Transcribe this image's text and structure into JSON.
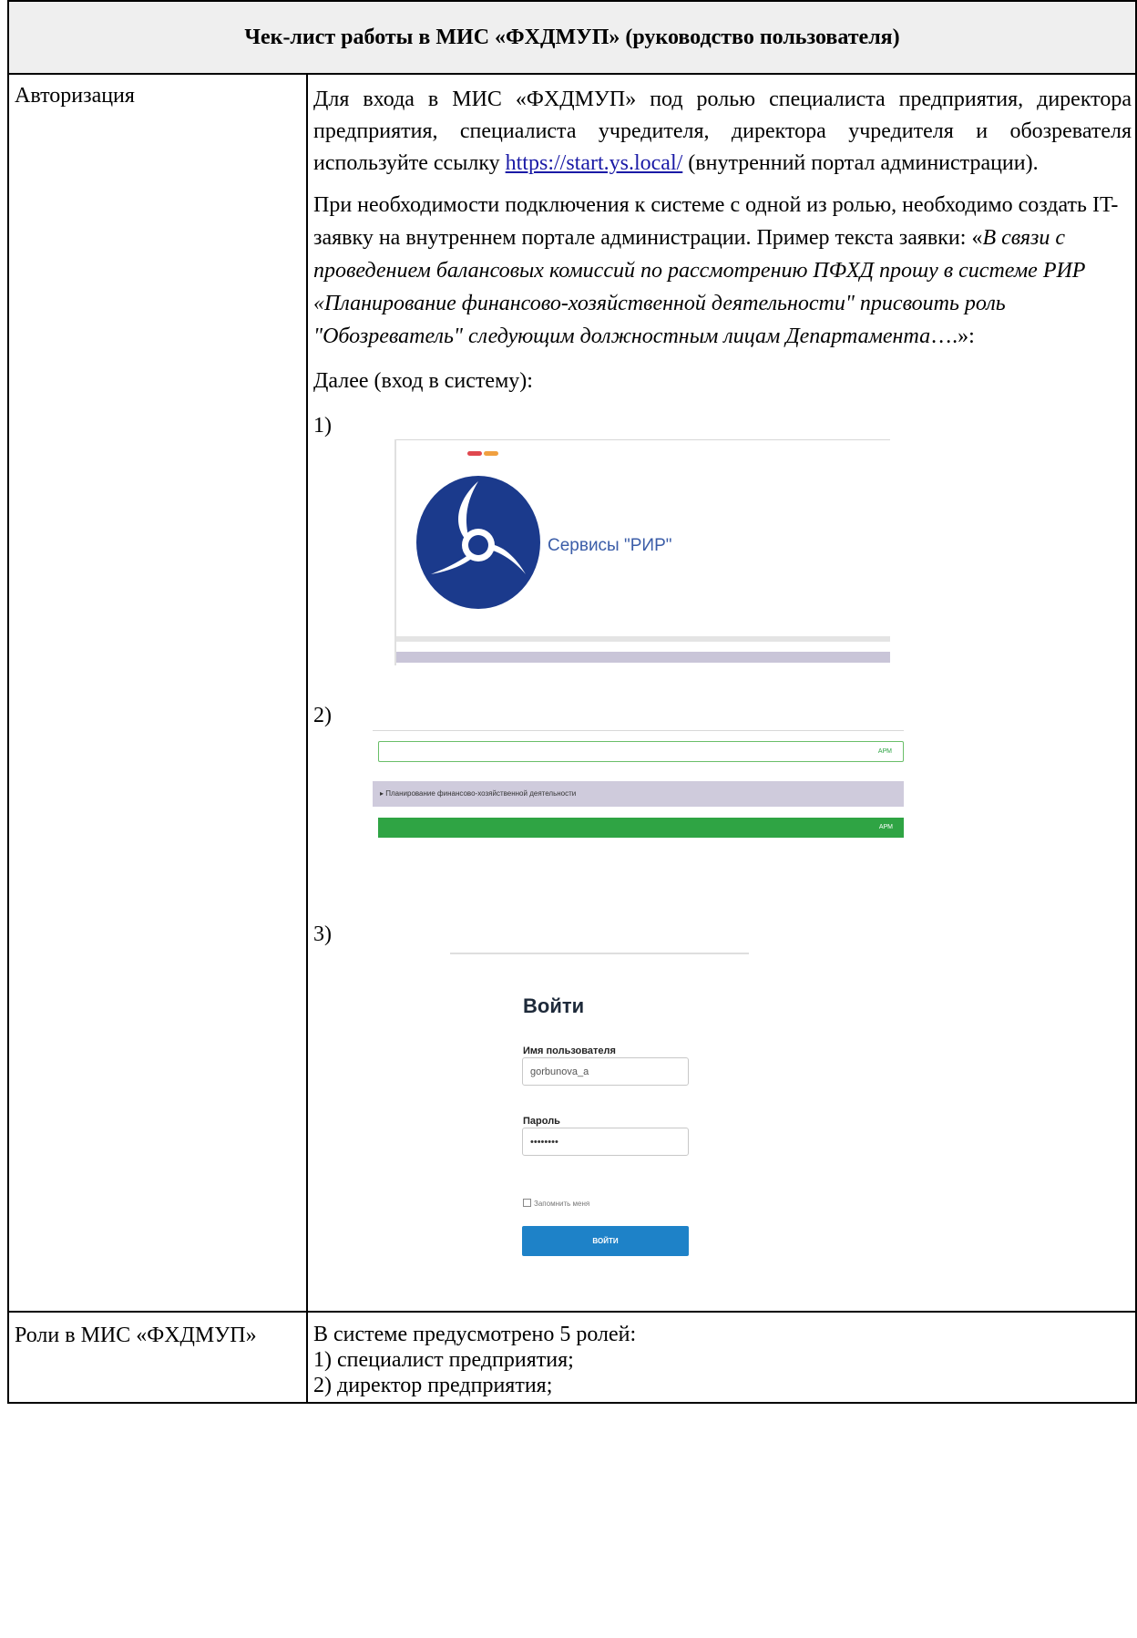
{
  "header": {
    "title": "Чек-лист работы в  МИС «ФХДМУП» (руководство пользователя)"
  },
  "rows": {
    "auth": {
      "label": "Авторизация",
      "para1_before": "Для входа в МИС «ФХДМУП» под ролью специалиста предприятия, директора предприятия, специалиста учредителя, директора учредителя и обозревателя используйте ссылку ",
      "para1_link": "https://start.ys.local/",
      "para1_after": " (внутренний портал администрации).",
      "para2_before": "При необходимости подключения к системе с одной из ролью, необходимо создать IT-заявку на внутреннем портале администрации. Пример текста заявки: «",
      "para2_italic": "В связи с проведением балансовых комиссий по рассмотрению ПФХД прошу в системе РИР «Планирование финансово-хозяйственной деятельности\" присвоить роль \"Обозреватель\" следующим должностным лицам Департамента",
      "para2_after": "….»:",
      "para3": "Далее (вход в систему):",
      "steps": [
        {
          "num": "1)",
          "service_text": "Сервисы \"РИР\""
        },
        {
          "num": "2)",
          "row_text": "▸ Планирование финансово-хозяйственной деятельности",
          "tag": "АРМ"
        },
        {
          "num": "3)",
          "login_title": "Войти",
          "username_label": "Имя пользователя",
          "username_value": "gorbunova_a",
          "password_label": "Пароль",
          "password_value": "••••••••",
          "remember_label": "Запомнить меня",
          "submit_label": "ВОЙТИ"
        }
      ]
    },
    "roles": {
      "label": "Роли в МИС «ФХДМУП»",
      "intro": "В системе предусмотрено 5 ролей:",
      "items": [
        "1) специалист предприятия;",
        "2) директор предприятия;"
      ]
    }
  },
  "colors": {
    "header_bg": "#efefef",
    "logo_blue": "#1b3a8c",
    "green": "#2fa444",
    "login_button": "#1e82c8"
  }
}
